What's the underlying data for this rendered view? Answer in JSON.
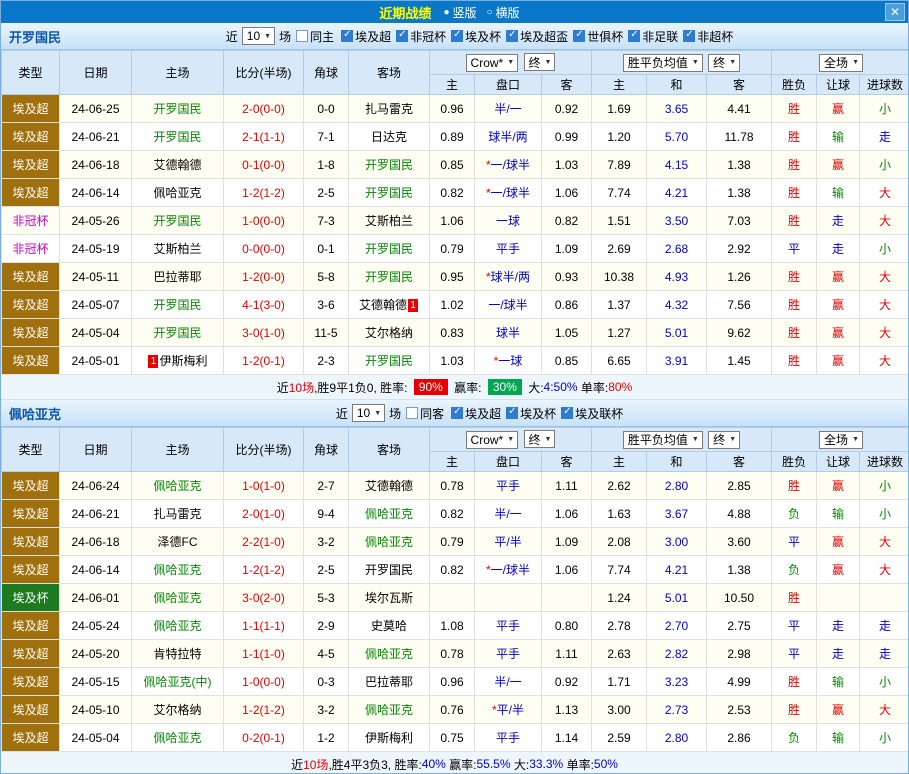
{
  "titlebar": {
    "title": "近期战绩",
    "view_vertical": "竖版",
    "view_horizontal": "横版",
    "radio_on_icon": "●",
    "radio_off_icon": "○",
    "close_icon": "✕"
  },
  "table_head": {
    "type": "类型",
    "date": "日期",
    "home": "主场",
    "score": "比分(半场)",
    "corner": "角球",
    "away": "客场",
    "odds_home": "主",
    "odds_handicap": "盘口",
    "odds_away": "客",
    "avg_home": "主",
    "avg_draw": "和",
    "avg_away": "客",
    "result": "胜负",
    "handicap_result": "让球",
    "goals_result": "进球数"
  },
  "controls": {
    "odds_company": "Crow*",
    "final_label": "终",
    "avg_label": "胜平负均值",
    "scope_label": "全场"
  },
  "sections": [
    {
      "team": "开罗国民",
      "filters": {
        "near": "近",
        "count": "10",
        "games": "场",
        "same": {
          "label": "同主",
          "checked": false
        },
        "leagues": [
          {
            "label": "埃及超",
            "checked": true
          },
          {
            "label": "非冠杯",
            "checked": true
          },
          {
            "label": "埃及杯",
            "checked": true
          },
          {
            "label": "埃及超盃",
            "checked": true
          },
          {
            "label": "世俱杯",
            "checked": true
          },
          {
            "label": "非足联",
            "checked": true
          },
          {
            "label": "非超杯",
            "checked": true
          }
        ]
      },
      "rows": [
        {
          "type": "埃及超",
          "date": "24-06-25",
          "home": "开罗国民",
          "home_focus": true,
          "score": "2-0(0-0)",
          "corner": "0-0",
          "away": "扎马雷克",
          "o_home": "0.96",
          "handicap": "半/一",
          "o_away": "0.92",
          "avg_home": "1.69",
          "avg_draw": "3.65",
          "avg_away": "4.41",
          "result": "胜",
          "let": "赢",
          "goals": "小"
        },
        {
          "type": "埃及超",
          "date": "24-06-21",
          "home": "开罗国民",
          "home_focus": true,
          "score": "2-1(1-1)",
          "corner": "7-1",
          "away": "日达克",
          "o_home": "0.89",
          "handicap": "球半/两",
          "o_away": "0.99",
          "avg_home": "1.20",
          "avg_draw": "5.70",
          "avg_away": "11.78",
          "result": "胜",
          "let": "输",
          "goals": "走"
        },
        {
          "type": "埃及超",
          "date": "24-06-18",
          "home": "艾德翰德",
          "away_focus": true,
          "score": "0-1(0-0)",
          "corner": "1-8",
          "away": "开罗国民",
          "o_home": "0.85",
          "handicap": "*一/球半",
          "o_away": "1.03",
          "avg_home": "7.89",
          "avg_draw": "4.15",
          "avg_away": "1.38",
          "result": "胜",
          "let": "赢",
          "goals": "小"
        },
        {
          "type": "埃及超",
          "date": "24-06-14",
          "home": "佩哈亚克",
          "away_focus": true,
          "score": "1-2(1-2)",
          "corner": "2-5",
          "away": "开罗国民",
          "o_home": "0.82",
          "handicap": "*一/球半",
          "o_away": "1.06",
          "avg_home": "7.74",
          "avg_draw": "4.21",
          "avg_away": "1.38",
          "result": "胜",
          "let": "输",
          "goals": "大"
        },
        {
          "type": "非冠杯",
          "date": "24-05-26",
          "home": "开罗国民",
          "home_focus": true,
          "score": "1-0(0-0)",
          "corner": "7-3",
          "away": "艾斯柏兰",
          "o_home": "1.06",
          "handicap": "一球",
          "o_away": "0.82",
          "avg_home": "1.51",
          "avg_draw": "3.50",
          "avg_away": "7.03",
          "result": "胜",
          "let": "走",
          "goals": "大"
        },
        {
          "type": "非冠杯",
          "date": "24-05-19",
          "home": "艾斯柏兰",
          "away_focus": true,
          "score": "0-0(0-0)",
          "corner": "0-1",
          "away": "开罗国民",
          "o_home": "0.79",
          "handicap": "平手",
          "o_away": "1.09",
          "avg_home": "2.69",
          "avg_draw": "2.68",
          "avg_away": "2.92",
          "result": "平",
          "let": "走",
          "goals": "小"
        },
        {
          "type": "埃及超",
          "date": "24-05-11",
          "home": "巴拉蒂耶",
          "away_focus": true,
          "score": "1-2(0-0)",
          "corner": "5-8",
          "away": "开罗国民",
          "o_home": "0.95",
          "handicap": "*球半/两",
          "o_away": "0.93",
          "avg_home": "10.38",
          "avg_draw": "4.93",
          "avg_away": "1.26",
          "result": "胜",
          "let": "赢",
          "goals": "大"
        },
        {
          "type": "埃及超",
          "date": "24-05-07",
          "home": "开罗国民",
          "home_focus": true,
          "score": "4-1(3-0)",
          "corner": "3-6",
          "away": "艾德翰德",
          "away_rc_post": "1",
          "o_home": "1.02",
          "handicap": "一/球半",
          "o_away": "0.86",
          "avg_home": "1.37",
          "avg_draw": "4.32",
          "avg_away": "7.56",
          "result": "胜",
          "let": "赢",
          "goals": "大"
        },
        {
          "type": "埃及超",
          "date": "24-05-04",
          "home": "开罗国民",
          "home_focus": true,
          "score": "3-0(1-0)",
          "corner": "11-5",
          "away": "艾尔格纳",
          "o_home": "0.83",
          "handicap": "球半",
          "o_away": "1.05",
          "avg_home": "1.27",
          "avg_draw": "5.01",
          "avg_away": "9.62",
          "result": "胜",
          "let": "赢",
          "goals": "大"
        },
        {
          "type": "埃及超",
          "date": "24-05-01",
          "home": "伊斯梅利",
          "home_rc_pre": "1",
          "away_focus": true,
          "score": "1-2(0-1)",
          "corner": "2-3",
          "away": "开罗国民",
          "o_home": "1.03",
          "handicap": "*一球",
          "o_away": "0.85",
          "avg_home": "6.65",
          "avg_draw": "3.91",
          "avg_away": "1.45",
          "result": "胜",
          "let": "赢",
          "goals": "大"
        }
      ],
      "footer": [
        {
          "t": "近",
          "c": "k"
        },
        {
          "t": "10场",
          "c": "r"
        },
        {
          "t": ",胜9平1负0, 胜率: ",
          "c": "k"
        },
        {
          "t": "90%",
          "badge": "red"
        },
        {
          "t": " 赢率: ",
          "c": "k"
        },
        {
          "t": "30%",
          "badge": "green"
        },
        {
          "t": " 大:",
          "c": "k"
        },
        {
          "t": "4:50%",
          "c": "b"
        },
        {
          "t": " 单率:",
          "c": "k"
        },
        {
          "t": "80%",
          "c": "r"
        }
      ]
    },
    {
      "team": "佩哈亚克",
      "filters": {
        "near": "近",
        "count": "10",
        "games": "场",
        "same": {
          "label": "同客",
          "checked": false
        },
        "leagues": [
          {
            "label": "埃及超",
            "checked": true
          },
          {
            "label": "埃及杯",
            "checked": true
          },
          {
            "label": "埃及联杯",
            "checked": true
          }
        ]
      },
      "rows": [
        {
          "type": "埃及超",
          "date": "24-06-24",
          "home": "佩哈亚克",
          "home_focus": true,
          "score": "1-0(1-0)",
          "corner": "2-7",
          "away": "艾德翰德",
          "o_home": "0.78",
          "handicap": "平手",
          "o_away": "1.11",
          "avg_home": "2.62",
          "avg_draw": "2.80",
          "avg_away": "2.85",
          "result": "胜",
          "let": "赢",
          "goals": "小"
        },
        {
          "type": "埃及超",
          "date": "24-06-21",
          "home": "扎马雷克",
          "away_focus": true,
          "score": "2-0(1-0)",
          "corner": "9-4",
          "away": "佩哈亚克",
          "o_home": "0.82",
          "handicap": "半/一",
          "o_away": "1.06",
          "avg_home": "1.63",
          "avg_draw": "3.67",
          "avg_away": "4.88",
          "result": "负",
          "let": "输",
          "goals": "小"
        },
        {
          "type": "埃及超",
          "date": "24-06-18",
          "home": "泽德FC",
          "away_focus": true,
          "score": "2-2(1-0)",
          "corner": "3-2",
          "away": "佩哈亚克",
          "o_home": "0.79",
          "handicap": "平/半",
          "o_away": "1.09",
          "avg_home": "2.08",
          "avg_draw": "3.00",
          "avg_away": "3.60",
          "result": "平",
          "let": "赢",
          "goals": "大"
        },
        {
          "type": "埃及超",
          "date": "24-06-14",
          "home": "佩哈亚克",
          "home_focus": true,
          "score": "1-2(1-2)",
          "corner": "2-5",
          "away": "开罗国民",
          "o_home": "0.82",
          "handicap": "*一/球半",
          "o_away": "1.06",
          "avg_home": "7.74",
          "avg_draw": "4.21",
          "avg_away": "1.38",
          "result": "负",
          "let": "赢",
          "goals": "大"
        },
        {
          "type": "埃及杯",
          "date": "24-06-01",
          "home": "佩哈亚克",
          "home_focus": true,
          "score": "3-0(2-0)",
          "corner": "5-3",
          "away": "埃尔瓦斯",
          "o_home": "",
          "handicap": "",
          "o_away": "",
          "avg_home": "1.24",
          "avg_draw": "5.01",
          "avg_away": "10.50",
          "result": "胜",
          "let": "",
          "goals": ""
        },
        {
          "type": "埃及超",
          "date": "24-05-24",
          "home": "佩哈亚克",
          "home_focus": true,
          "score": "1-1(1-1)",
          "corner": "2-9",
          "away": "史莫哈",
          "o_home": "1.08",
          "handicap": "平手",
          "o_away": "0.80",
          "avg_home": "2.78",
          "avg_draw": "2.70",
          "avg_away": "2.75",
          "result": "平",
          "let": "走",
          "goals": "走"
        },
        {
          "type": "埃及超",
          "date": "24-05-20",
          "home": "肯特拉特",
          "away_focus": true,
          "score": "1-1(1-0)",
          "corner": "4-5",
          "away": "佩哈亚克",
          "o_home": "0.78",
          "handicap": "平手",
          "o_away": "1.11",
          "avg_home": "2.63",
          "avg_draw": "2.82",
          "avg_away": "2.98",
          "result": "平",
          "let": "走",
          "goals": "走"
        },
        {
          "type": "埃及超",
          "date": "24-05-15",
          "home": "佩哈亚克(中)",
          "home_focus": true,
          "score": "1-0(0-0)",
          "corner": "0-3",
          "away": "巴拉蒂耶",
          "o_home": "0.96",
          "handicap": "半/一",
          "o_away": "0.92",
          "avg_home": "1.71",
          "avg_draw": "3.23",
          "avg_away": "4.99",
          "result": "胜",
          "let": "输",
          "goals": "小"
        },
        {
          "type": "埃及超",
          "date": "24-05-10",
          "home": "艾尔格纳",
          "away_focus": true,
          "score": "1-2(1-2)",
          "corner": "3-2",
          "away": "佩哈亚克",
          "o_home": "0.76",
          "handicap": "*平/半",
          "o_away": "1.13",
          "avg_home": "3.00",
          "avg_draw": "2.73",
          "avg_away": "2.53",
          "result": "胜",
          "let": "赢",
          "goals": "大"
        },
        {
          "type": "埃及超",
          "date": "24-05-04",
          "home": "佩哈亚克",
          "home_focus": true,
          "score": "0-2(0-1)",
          "corner": "1-2",
          "away": "伊斯梅利",
          "o_home": "0.75",
          "handicap": "平手",
          "o_away": "1.14",
          "avg_home": "2.59",
          "avg_draw": "2.80",
          "avg_away": "2.86",
          "result": "负",
          "let": "输",
          "goals": "小"
        }
      ],
      "footer": [
        {
          "t": "近",
          "c": "k"
        },
        {
          "t": "10场",
          "c": "r"
        },
        {
          "t": ",胜4平3负3, 胜率:",
          "c": "k"
        },
        {
          "t": "40%",
          "c": "b"
        },
        {
          "t": " 赢率:",
          "c": "k"
        },
        {
          "t": "55.5%",
          "c": "b"
        },
        {
          "t": " 大:",
          "c": "k"
        },
        {
          "t": "33.3%",
          "c": "b"
        },
        {
          "t": " 单率:",
          "c": "k"
        },
        {
          "t": "50%",
          "c": "b"
        }
      ]
    }
  ]
}
